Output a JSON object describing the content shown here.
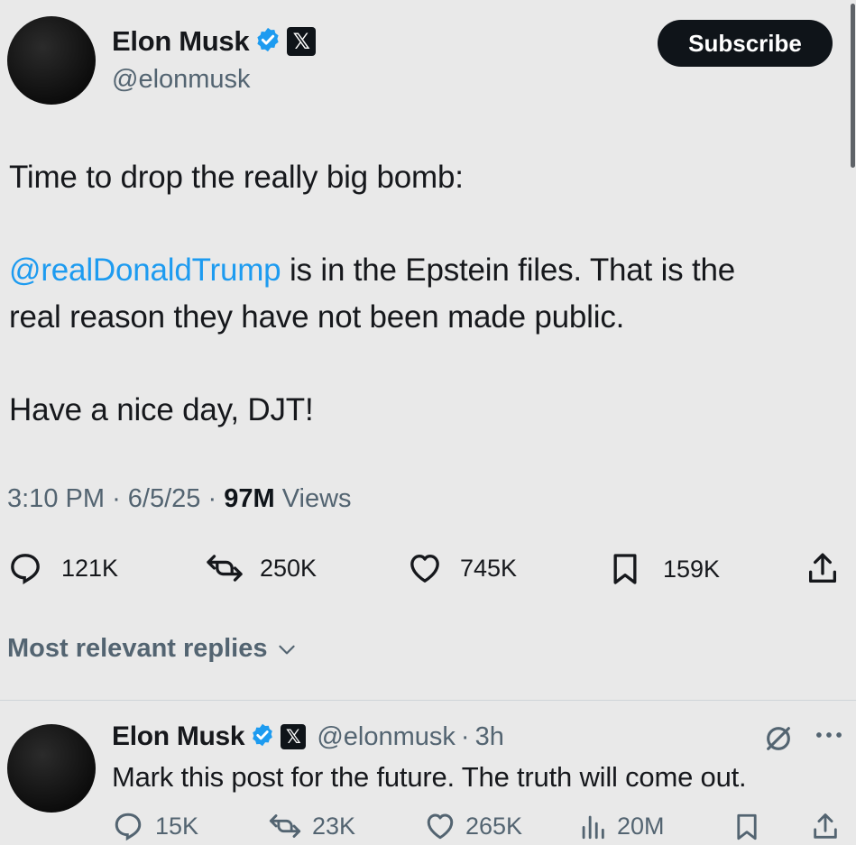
{
  "tweet": {
    "author_name": "Elon Musk",
    "author_handle": "@elonmusk",
    "subscribe_label": "Subscribe",
    "line1": "Time to drop the really big bomb:",
    "mention": "@realDonaldTrump",
    "line2_rest": " is in the Epstein files. That is the",
    "line3": "real reason they have not been made public.",
    "line4": "Have a nice day, DJT!",
    "time": "3:10 PM",
    "date": "6/5/25",
    "views_count": "97M",
    "views_label": "Views",
    "dot": "·",
    "actions": {
      "replies": "121K",
      "reposts": "250K",
      "likes": "745K",
      "bookmarks": "159K"
    },
    "icons": [
      "verified-badge-icon",
      "x-logo-icon",
      "reply-icon",
      "repost-icon",
      "like-icon",
      "bookmark-icon",
      "share-icon"
    ]
  },
  "replies_sort": {
    "label": "Most relevant replies",
    "icon": "chevron-down-icon"
  },
  "reply": {
    "author_name": "Elon Musk",
    "author_handle": "@elonmusk",
    "age": "3h",
    "text": "Mark this post for the future. The truth will come out.",
    "actions": {
      "replies": "15K",
      "reposts": "23K",
      "likes": "265K",
      "views": "20M"
    }
  },
  "colors": {
    "background": "#e9e9e9",
    "text": "#0f1419",
    "secondary": "#536471",
    "link": "#1d9bf0",
    "verified": "#1d9bf0"
  }
}
